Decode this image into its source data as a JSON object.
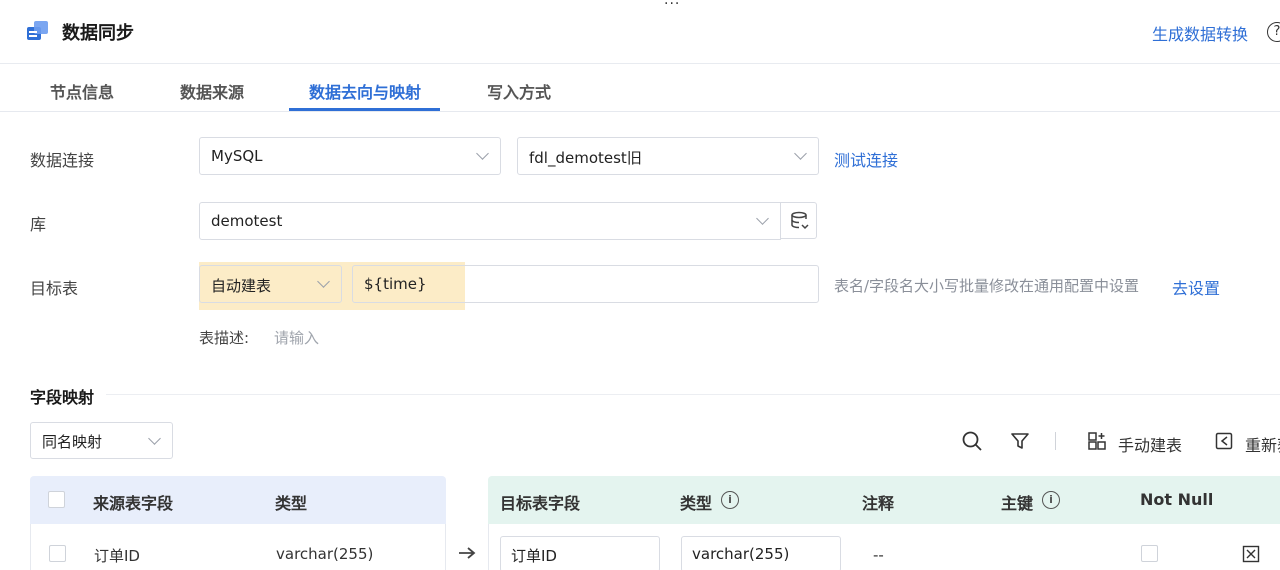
{
  "header": {
    "title": "数据同步",
    "generate_link": "生成数据转换",
    "help_glyph": "?",
    "more_glyph": "···"
  },
  "tabs": [
    {
      "label": "节点信息",
      "active": false
    },
    {
      "label": "数据来源",
      "active": false
    },
    {
      "label": "数据去向与映射",
      "active": true
    },
    {
      "label": "写入方式",
      "active": false
    }
  ],
  "form": {
    "connection": {
      "label": "数据连接",
      "type_value": "MySQL",
      "conn_value": "fdl_demotest旧",
      "test_link": "测试连接"
    },
    "database": {
      "label": "库",
      "value": "demotest"
    },
    "target_table": {
      "label": "目标表",
      "mode_value": "自动建表",
      "name_value": "${time}",
      "hint": "表名/字段名大小写批量修改在通用配置中设置",
      "settings_link": "去设置"
    },
    "description": {
      "label": "表描述:",
      "placeholder": "请输入"
    }
  },
  "mapping": {
    "title": "字段映射",
    "mode_value": "同名映射",
    "toolbar": {
      "manual_create": "手动建表",
      "refresh": "重新获"
    },
    "source_columns": [
      "来源表字段",
      "类型"
    ],
    "target_columns": [
      "目标表字段",
      "类型",
      "注释",
      "主键",
      "Not Null"
    ],
    "rows": [
      {
        "source_field": "订单ID",
        "source_type": "varchar(255)",
        "target_field": "订单ID",
        "target_type": "varchar(255)",
        "comment": "--"
      }
    ]
  },
  "colors": {
    "accent": "#2f6fd6",
    "highlight": "#fbe9bd",
    "source_header": "#e8eefb",
    "target_header": "#e4f4ef"
  }
}
